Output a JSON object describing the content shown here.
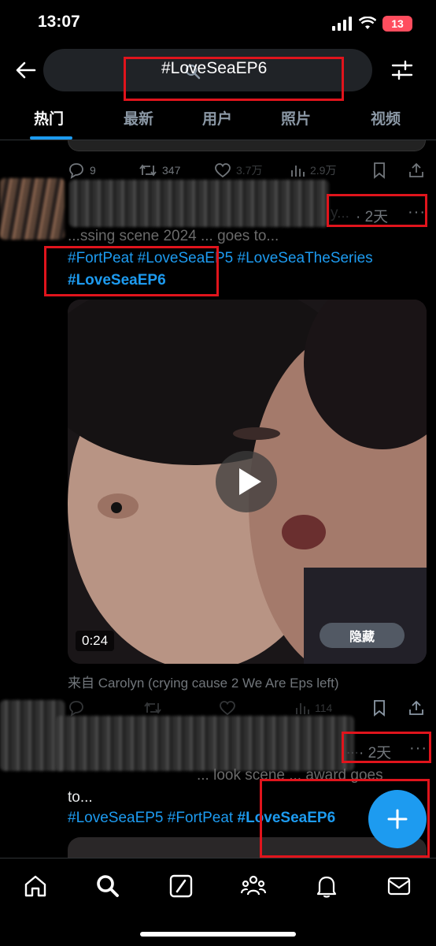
{
  "status": {
    "time": "13:07",
    "battery": "13"
  },
  "search": {
    "query": "#LoveSeaEP6"
  },
  "tabs": [
    {
      "label": "热门"
    },
    {
      "label": "最新"
    },
    {
      "label": "用户"
    },
    {
      "label": "照片"
    },
    {
      "label": "视频"
    }
  ],
  "prev_tweet": {
    "actions": {
      "replies": "9",
      "retweets": "347",
      "likes": "3.7万",
      "views": "2.9万"
    }
  },
  "tweet1": {
    "age": "· 2天",
    "handle_fragment": "y...",
    "text_fragment": "...ssing scene 2024 ... goes to...",
    "hashtags_line1": [
      "#FortPeat",
      "#LoveSeaEP5",
      "#LoveSeaTheSeries"
    ],
    "hashtag_bold": "#LoveSeaEP6",
    "media": {
      "duration": "0:24",
      "hide_label": "隐藏"
    },
    "source": "来自 Carolyn (crying cause 2 We Are Eps left)",
    "actions": {
      "views": "114"
    }
  },
  "tweet2": {
    "age": "· 2天",
    "handle_fragment": "...",
    "text_fragment": "... look scene ... award goes",
    "text_line2": "to...",
    "hashtags": [
      "#LoveSeaEP5",
      "#FortPeat"
    ],
    "hashtag_bold": "#LoveSeaEP6"
  },
  "colors": {
    "accent": "#1d9bf0",
    "annotation": "#e0141c",
    "background": "#000000"
  }
}
